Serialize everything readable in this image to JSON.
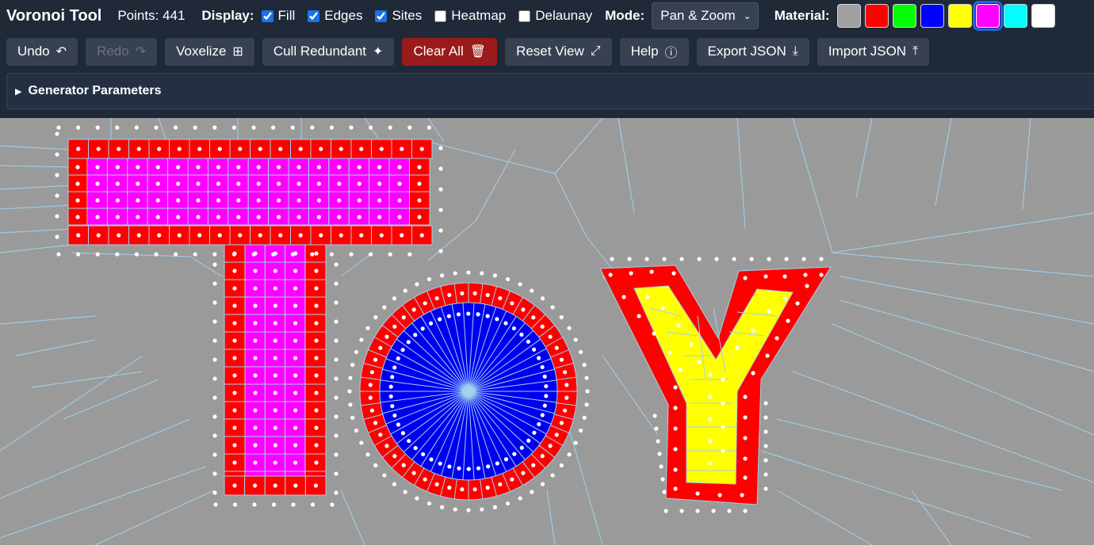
{
  "app": {
    "title": "Voronoi Tool",
    "points_text": "Points: 441"
  },
  "display": {
    "label": "Display:",
    "options": [
      {
        "label": "Fill",
        "checked": true
      },
      {
        "label": "Edges",
        "checked": true
      },
      {
        "label": "Sites",
        "checked": true
      },
      {
        "label": "Heatmap",
        "checked": false
      },
      {
        "label": "Delaunay",
        "checked": false
      }
    ]
  },
  "mode": {
    "label": "Mode:",
    "value": "Pan & Zoom"
  },
  "material": {
    "label": "Material:",
    "swatches": [
      "#a0a0a0",
      "#ff0000",
      "#00ff00",
      "#0000ff",
      "#ffff00",
      "#ff00ff",
      "#00ffff",
      "#ffffff"
    ],
    "selected_index": 5
  },
  "toolbar": {
    "undo": "Undo",
    "redo": "Redo",
    "voxelize": "Voxelize",
    "cull": "Cull Redundant",
    "clear": "Clear All",
    "reset": "Reset View",
    "help": "Help",
    "export": "Export JSON",
    "import": "Import JSON"
  },
  "icons": {
    "undo": "undo-icon",
    "redo": "redo-icon",
    "voxelize": "grid-icon",
    "cull": "sparkle-icon",
    "clear": "trash-icon",
    "reset": "compress-icon",
    "help": "help-circle-icon",
    "export": "download-icon",
    "import": "upload-icon"
  },
  "params": {
    "label": "Generator Parameters",
    "expanded": false
  },
  "colors": {
    "background_cell": "#9a9a9a",
    "edge": "#9fd3f0",
    "site": "#ffffff",
    "red": "#ff0000",
    "magenta": "#ff00ff",
    "blue": "#0000ee",
    "yellow": "#ffff00"
  },
  "canvas": {
    "text": "TOY"
  }
}
